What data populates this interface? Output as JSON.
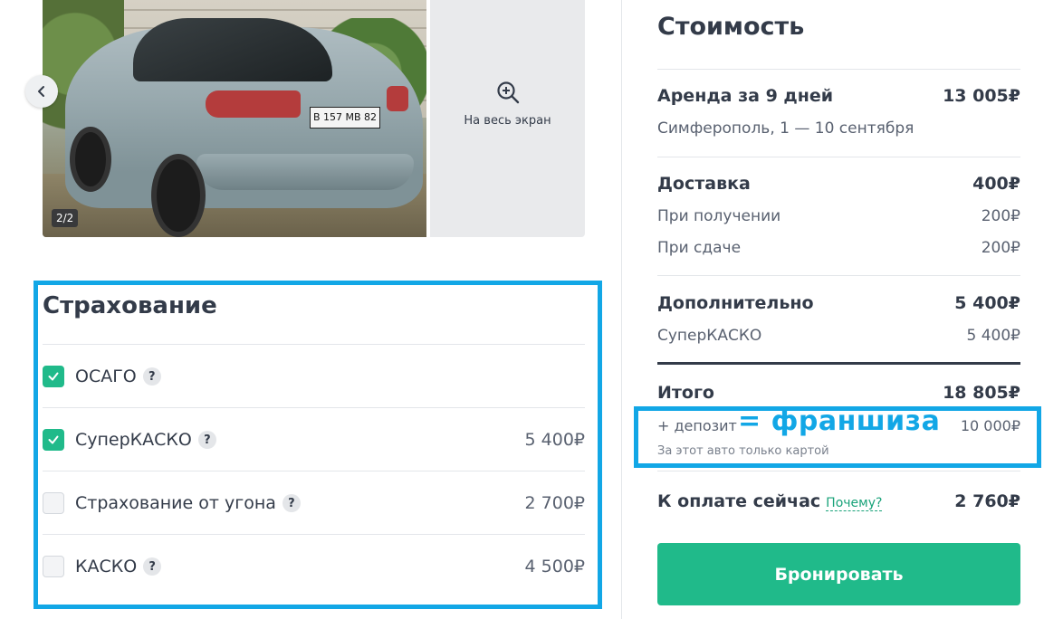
{
  "gallery": {
    "photo_counter": "2/2",
    "plate_text": "В 157 МВ 82",
    "fullscreen_label": "На весь экран",
    "icons": {
      "prev": "chevron-left-icon",
      "zoom": "zoom-in-icon"
    }
  },
  "insurance": {
    "title": "Страхование",
    "items": [
      {
        "name": "ОСАГО",
        "checked": true,
        "price": ""
      },
      {
        "name": "СуперКАСКО",
        "checked": true,
        "price": "5 400₽"
      },
      {
        "name": "Страхование от угона",
        "checked": false,
        "price": "2 700₽"
      },
      {
        "name": "КАСКО",
        "checked": false,
        "price": "4 500₽"
      }
    ],
    "help_symbol": "?"
  },
  "cost": {
    "title": "Стоимость",
    "rent": {
      "label": "Аренда за 9 дней",
      "value": "13 005₽",
      "details": "Симферополь, 1 — 10 сентября"
    },
    "delivery": {
      "label": "Доставка",
      "value": "400₽",
      "pickup": {
        "label": "При получении",
        "value": "200₽"
      },
      "return": {
        "label": "При сдаче",
        "value": "200₽"
      }
    },
    "extra": {
      "label": "Дополнительно",
      "value": "5 400₽",
      "item": {
        "label": "СуперКАСКО",
        "value": "5 400₽"
      }
    },
    "total": {
      "label": "Итого",
      "value": "18 805₽"
    },
    "deposit": {
      "label": "+ депозит",
      "value": "10 000₽",
      "note": "За этот авто только картой"
    },
    "annotation": "= франшиза",
    "pay_now": {
      "label": "К оплате сейчас",
      "why": "Почему?",
      "value": "2 760₽"
    },
    "book_button": "Бронировать"
  },
  "colors": {
    "accent": "#20ba8a",
    "annotation": "#12a7e6",
    "text": "#333b49",
    "muted": "#596170"
  }
}
